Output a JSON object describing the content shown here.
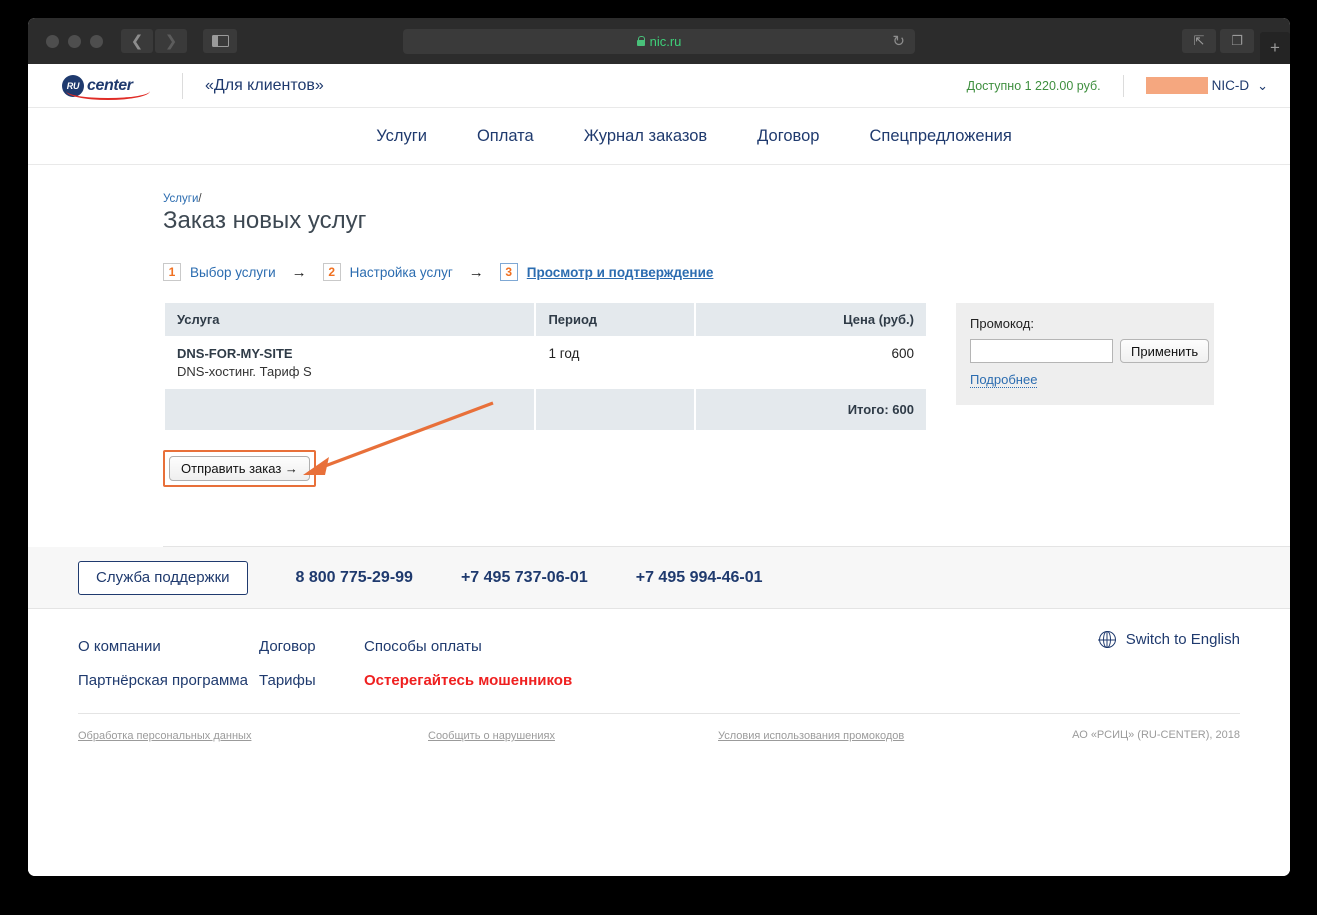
{
  "browser": {
    "url": "nic.ru",
    "lock_icon": "lock-icon",
    "reload_icon": "reload-icon",
    "back_icon": "chevron-left-icon",
    "forward_icon": "chevron-right-icon",
    "sidebar_icon": "sidebar-toggle-icon",
    "share_icon": "share-icon",
    "tabs_icon": "show-tabs-icon",
    "newtab_icon": "plus-icon"
  },
  "header": {
    "logo_mark": "RU",
    "logo_text": "center",
    "slogan": "«Для клиентов»",
    "balance": "Доступно 1 220.00 руб.",
    "account_name": "NIC-D",
    "chevron": "chevron-down-icon"
  },
  "nav": {
    "items": [
      {
        "label": "Услуги"
      },
      {
        "label": "Оплата"
      },
      {
        "label": "Журнал заказов"
      },
      {
        "label": "Договор"
      },
      {
        "label": "Спецпредложения"
      }
    ]
  },
  "breadcrumb": {
    "parent": "Услуги",
    "separator": "/"
  },
  "page": {
    "title": "Заказ новых услуг"
  },
  "steps": {
    "arrow": "→",
    "items": [
      {
        "num": "1",
        "label": "Выбор услуги",
        "active": false
      },
      {
        "num": "2",
        "label": "Настройка услуг",
        "active": false
      },
      {
        "num": "3",
        "label": "Просмотр и подтверждение",
        "active": true
      }
    ]
  },
  "order": {
    "columns": {
      "service": "Услуга",
      "period": "Период",
      "price": "Цена (руб.)"
    },
    "rows": [
      {
        "code": "DNS-FOR-MY-SITE",
        "description": "DNS-хостинг. Тариф S",
        "period": "1 год",
        "price": "600"
      }
    ],
    "total_label": "Итого: 600",
    "submit_label": "Отправить заказ →"
  },
  "promo": {
    "label": "Промокод:",
    "value": "",
    "placeholder": "",
    "apply_label": "Применить",
    "more_label": "Подробнее"
  },
  "support": {
    "button_label": "Служба поддержки",
    "phones": [
      "8 800 775-29-99",
      "+7 495 737-06-01",
      "+7 495 994-46-01"
    ]
  },
  "footer": {
    "col1": [
      {
        "label": "О компании",
        "alert": false
      },
      {
        "label": "Партнёрская программа",
        "alert": false
      }
    ],
    "col2": [
      {
        "label": "Договор",
        "alert": false
      },
      {
        "label": "Тарифы",
        "alert": false
      }
    ],
    "col3": [
      {
        "label": "Способы оплаты",
        "alert": false
      },
      {
        "label": "Остерегайтесь мошенников",
        "alert": true
      }
    ],
    "switch_language": "Switch to English",
    "globe_icon": "globe-icon",
    "legal": [
      "Обработка персональных данных",
      "Сообщить о нарушениях",
      "Условия использования промокодов"
    ],
    "copyright": "АО «РСИЦ» (RU-CENTER), 2018"
  },
  "annotation": {
    "color": "#e8703a"
  }
}
